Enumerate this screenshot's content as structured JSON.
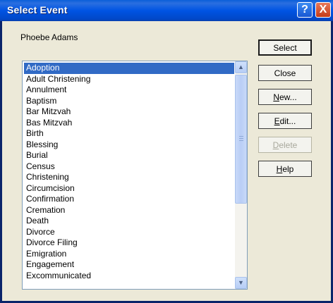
{
  "window": {
    "title": "Select Event",
    "help_glyph": "?",
    "close_glyph": "X"
  },
  "person_name": "Phoebe Adams",
  "events": {
    "items": [
      "Adoption",
      "Adult Christening",
      "Annulment",
      "Baptism",
      "Bar Mitzvah",
      "Bas Mitzvah",
      "Birth",
      "Blessing",
      "Burial",
      "Census",
      "Christening",
      "Circumcision",
      "Confirmation",
      "Cremation",
      "Death",
      "Divorce",
      "Divorce Filing",
      "Emigration",
      "Engagement",
      "Excommunicated"
    ],
    "selected": "Adoption"
  },
  "buttons": {
    "select": "Select",
    "close": "Close",
    "new": {
      "mnemonic": "N",
      "rest": "ew..."
    },
    "edit": {
      "mnemonic": "E",
      "rest": "dit..."
    },
    "delete": {
      "mnemonic": "D",
      "rest": "elete",
      "enabled": false
    },
    "help": {
      "mnemonic": "H",
      "rest": "elp"
    }
  },
  "colors": {
    "titlebar": "#0054e3",
    "selection": "#316ac5",
    "dialog_bg": "#ece9d8"
  }
}
